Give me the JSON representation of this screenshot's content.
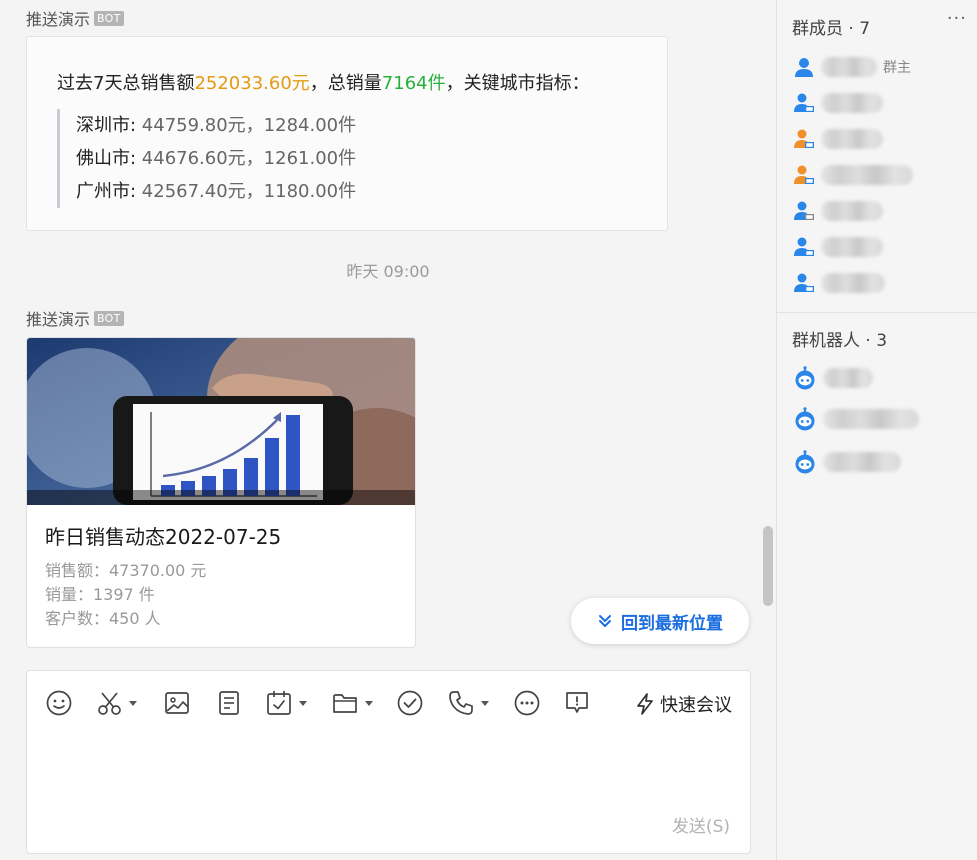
{
  "chat": {
    "sender_name": "推送演示",
    "bot_tag": "BOT",
    "report": {
      "lead_prefix": "过去7天总销售额",
      "total_amount": "252033.60元",
      "lead_mid": "，总销量",
      "total_qty": "7164件",
      "lead_suffix": "，关键城市指标：",
      "cities": [
        {
          "name": "深圳市: ",
          "value": "44759.80元，1284.00件"
        },
        {
          "name": "佛山市: ",
          "value": "44676.60元，1261.00件"
        },
        {
          "name": "广州市: ",
          "value": "42567.40元，1180.00件"
        }
      ]
    },
    "time_separator": "昨天 09:00",
    "news_card": {
      "title": "昨日销售动态2022-07-25",
      "lines": [
        "销售额：47370.00 元",
        "销量：1397 件",
        "客户数：450 人"
      ]
    },
    "jump_latest": "回到最新位置"
  },
  "composer": {
    "toolbar": [
      "emoji-icon",
      "scissors-icon",
      "image-icon",
      "doc-icon",
      "calendar-check-icon",
      "folder-icon",
      "check-circle-icon",
      "phone-icon",
      "more-circle-icon",
      "chat-alert-icon"
    ],
    "quick_meeting": "快速会议",
    "send": "发送(S)"
  },
  "sidebar": {
    "members_title": "群成员 · 7",
    "more": "···",
    "owner_tag": "群主",
    "bots_title": "群机器人 · 3"
  },
  "colors": {
    "accent": "#1b6ee0",
    "amount": "#e49a12",
    "qty": "#27b03b",
    "member_blue": "#2a86e8",
    "member_orange": "#f0902a"
  }
}
